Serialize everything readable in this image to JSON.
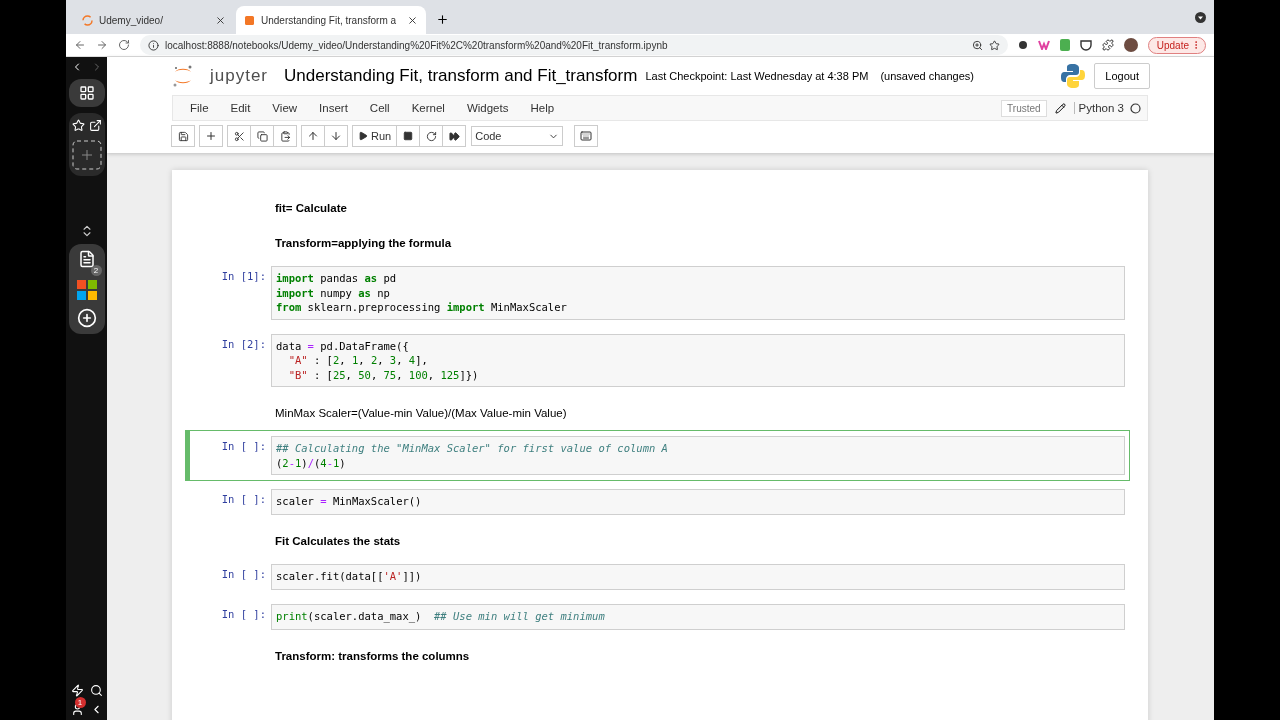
{
  "browser": {
    "tabs": [
      {
        "title": "Udemy_video/",
        "selected": false
      },
      {
        "title": "Understanding Fit, transform a",
        "selected": true
      }
    ],
    "address": "localhost:8888/notebooks/Udemy_video/Understanding%20Fit%2C%20transform%20and%20Fit_transform.ipynb",
    "update_button": "Update"
  },
  "sidebar": {
    "tabs_badge": "2",
    "profile_badge": "1"
  },
  "header": {
    "logo_text": "jupyter",
    "title": "Understanding Fit, transform and Fit_transform",
    "checkpoint": "Last Checkpoint: Last Wednesday at 4:38 PM",
    "unsaved": "(unsaved changes)",
    "logout": "Logout"
  },
  "menu": [
    "File",
    "Edit",
    "View",
    "Insert",
    "Cell",
    "Kernel",
    "Widgets",
    "Help"
  ],
  "kernel": {
    "trusted": "Trusted",
    "name": "Python 3",
    "busy": false
  },
  "toolbar": {
    "run": "Run",
    "cell_type": "Code"
  },
  "cells": [
    {
      "kind": "markdown",
      "bold": true,
      "text": "fit= Calculate"
    },
    {
      "kind": "markdown",
      "bold": true,
      "text": "Transform=applying the formula"
    },
    {
      "kind": "code",
      "prompt": "In [1]:",
      "selected": false,
      "lines": [
        [
          {
            "kind": "keyword",
            "text": "import"
          },
          {
            "kind": "plain",
            "text": " pandas "
          },
          {
            "kind": "keyword",
            "text": "as"
          },
          {
            "kind": "plain",
            "text": " pd"
          }
        ],
        [
          {
            "kind": "keyword",
            "text": "import"
          },
          {
            "kind": "plain",
            "text": " numpy "
          },
          {
            "kind": "keyword",
            "text": "as"
          },
          {
            "kind": "plain",
            "text": " np"
          }
        ],
        [
          {
            "kind": "keyword",
            "text": "from"
          },
          {
            "kind": "plain",
            "text": " sklearn.preprocessing "
          },
          {
            "kind": "keyword",
            "text": "import"
          },
          {
            "kind": "plain",
            "text": " MinMaxScaler"
          }
        ]
      ]
    },
    {
      "kind": "code",
      "prompt": "In [2]:",
      "selected": false,
      "lines": [
        [
          {
            "kind": "plain",
            "text": "data "
          },
          {
            "kind": "operator",
            "text": "="
          },
          {
            "kind": "plain",
            "text": " pd.DataFrame({"
          }
        ],
        [
          {
            "kind": "string",
            "text": "  \"A\""
          },
          {
            "kind": "plain",
            "text": " : ["
          },
          {
            "kind": "number",
            "text": "2"
          },
          {
            "kind": "plain",
            "text": ", "
          },
          {
            "kind": "number",
            "text": "1"
          },
          {
            "kind": "plain",
            "text": ", "
          },
          {
            "kind": "number",
            "text": "2"
          },
          {
            "kind": "plain",
            "text": ", "
          },
          {
            "kind": "number",
            "text": "3"
          },
          {
            "kind": "plain",
            "text": ", "
          },
          {
            "kind": "number",
            "text": "4"
          },
          {
            "kind": "plain",
            "text": "],"
          }
        ],
        [
          {
            "kind": "string",
            "text": "  \"B\""
          },
          {
            "kind": "plain",
            "text": " : ["
          },
          {
            "kind": "number",
            "text": "25"
          },
          {
            "kind": "plain",
            "text": ", "
          },
          {
            "kind": "number",
            "text": "50"
          },
          {
            "kind": "plain",
            "text": ", "
          },
          {
            "kind": "number",
            "text": "75"
          },
          {
            "kind": "plain",
            "text": ", "
          },
          {
            "kind": "number",
            "text": "100"
          },
          {
            "kind": "plain",
            "text": ", "
          },
          {
            "kind": "number",
            "text": "125"
          },
          {
            "kind": "plain",
            "text": "]})"
          }
        ]
      ]
    },
    {
      "kind": "markdown",
      "bold": false,
      "text": "MinMax Scaler=(Value-min Value)/(Max Value-min Value)"
    },
    {
      "kind": "code",
      "prompt": "In [ ]:",
      "selected": true,
      "lines": [
        [
          {
            "kind": "comment",
            "text": "## Calculating the \"MinMax Scaler\" for first value of column A"
          }
        ],
        [
          {
            "kind": "plain",
            "text": "("
          },
          {
            "kind": "number",
            "text": "2"
          },
          {
            "kind": "operator",
            "text": "-"
          },
          {
            "kind": "number",
            "text": "1"
          },
          {
            "kind": "plain",
            "text": ")"
          },
          {
            "kind": "operator",
            "text": "/"
          },
          {
            "kind": "plain",
            "text": "("
          },
          {
            "kind": "number",
            "text": "4"
          },
          {
            "kind": "operator",
            "text": "-"
          },
          {
            "kind": "number",
            "text": "1"
          },
          {
            "kind": "plain",
            "text": ")"
          }
        ]
      ]
    },
    {
      "kind": "code",
      "prompt": "In [ ]:",
      "selected": false,
      "lines": [
        [
          {
            "kind": "plain",
            "text": "scaler "
          },
          {
            "kind": "operator",
            "text": "="
          },
          {
            "kind": "plain",
            "text": " MinMaxScaler()"
          }
        ]
      ]
    },
    {
      "kind": "markdown",
      "bold": true,
      "text": "Fit Calculates the stats"
    },
    {
      "kind": "code",
      "prompt": "In [ ]:",
      "selected": false,
      "lines": [
        [
          {
            "kind": "plain",
            "text": "scaler.fit(data[["
          },
          {
            "kind": "string",
            "text": "'A'"
          },
          {
            "kind": "plain",
            "text": "]])"
          }
        ]
      ]
    },
    {
      "kind": "code",
      "prompt": "In [ ]:",
      "selected": false,
      "lines": [
        [
          {
            "kind": "builtin",
            "text": "print"
          },
          {
            "kind": "plain",
            "text": "(scaler.data_max_)  "
          },
          {
            "kind": "comment",
            "text": "## Use min will get minimum"
          }
        ]
      ]
    },
    {
      "kind": "markdown",
      "bold": true,
      "text": "Transform: transforms the columns"
    }
  ]
}
